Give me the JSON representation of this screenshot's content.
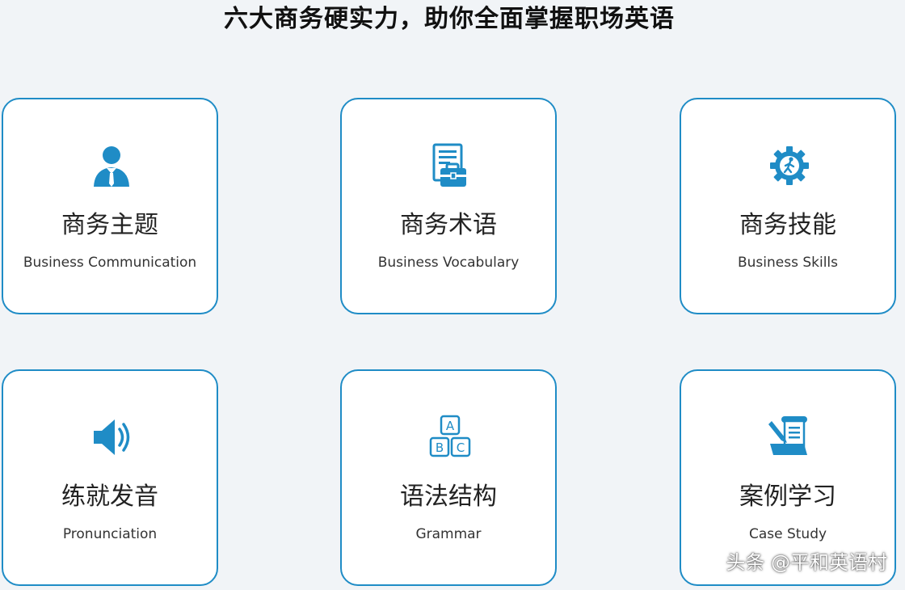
{
  "headline": "六大商务硬实力，助你全面掌握职场英语",
  "colors": {
    "accent": "#1f8cc6",
    "background": "#f1f4f7",
    "card_background": "#ffffff",
    "text": "#222222"
  },
  "cards": [
    {
      "icon": "businessman-icon",
      "title": "商务主题",
      "subtitle": "Business Communication"
    },
    {
      "icon": "briefcase-document-icon",
      "title": "商务术语",
      "subtitle": "Business Vocabulary"
    },
    {
      "icon": "gear-person-icon",
      "title": "商务技能",
      "subtitle": "Business Skills"
    },
    {
      "icon": "speaker-icon",
      "title": "练就发音",
      "subtitle": "Pronunciation"
    },
    {
      "icon": "abc-blocks-icon",
      "title": "语法结构",
      "subtitle": "Grammar"
    },
    {
      "icon": "scroll-pen-icon",
      "title": "案例学习",
      "subtitle": "Case Study"
    }
  ],
  "watermark": "头条 @平和英语村"
}
